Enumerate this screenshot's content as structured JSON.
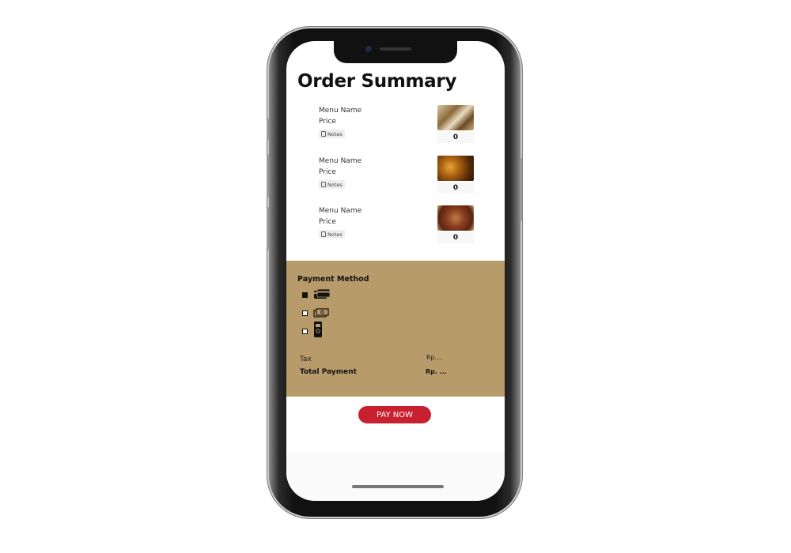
{
  "page": {
    "title": "Order Summary"
  },
  "order_items": [
    {
      "name": "Menu Name",
      "price": "Price",
      "notes_label": "Notes",
      "quantity": "0",
      "image": "food-photo-grilled"
    },
    {
      "name": "Menu Name",
      "price": "Price",
      "notes_label": "Notes",
      "quantity": "0",
      "image": "food-photo-fried"
    },
    {
      "name": "Menu Name",
      "price": "Price",
      "notes_label": "Notes",
      "quantity": "0",
      "image": "food-photo-satay"
    }
  ],
  "payment": {
    "title": "Payment Method",
    "methods": [
      {
        "icon": "credit-card-icon",
        "selected": true
      },
      {
        "icon": "cash-icon",
        "selected": false
      },
      {
        "icon": "mobile-payment-icon",
        "selected": false
      }
    ],
    "tax_label": "Tax",
    "tax_value": "Rp....",
    "total_label": "Total Payment",
    "total_value": "Rp. ...",
    "panel_color": "#b79b6a"
  },
  "actions": {
    "pay_now_label": "PAY NOW",
    "pay_now_color": "#c8202f"
  }
}
